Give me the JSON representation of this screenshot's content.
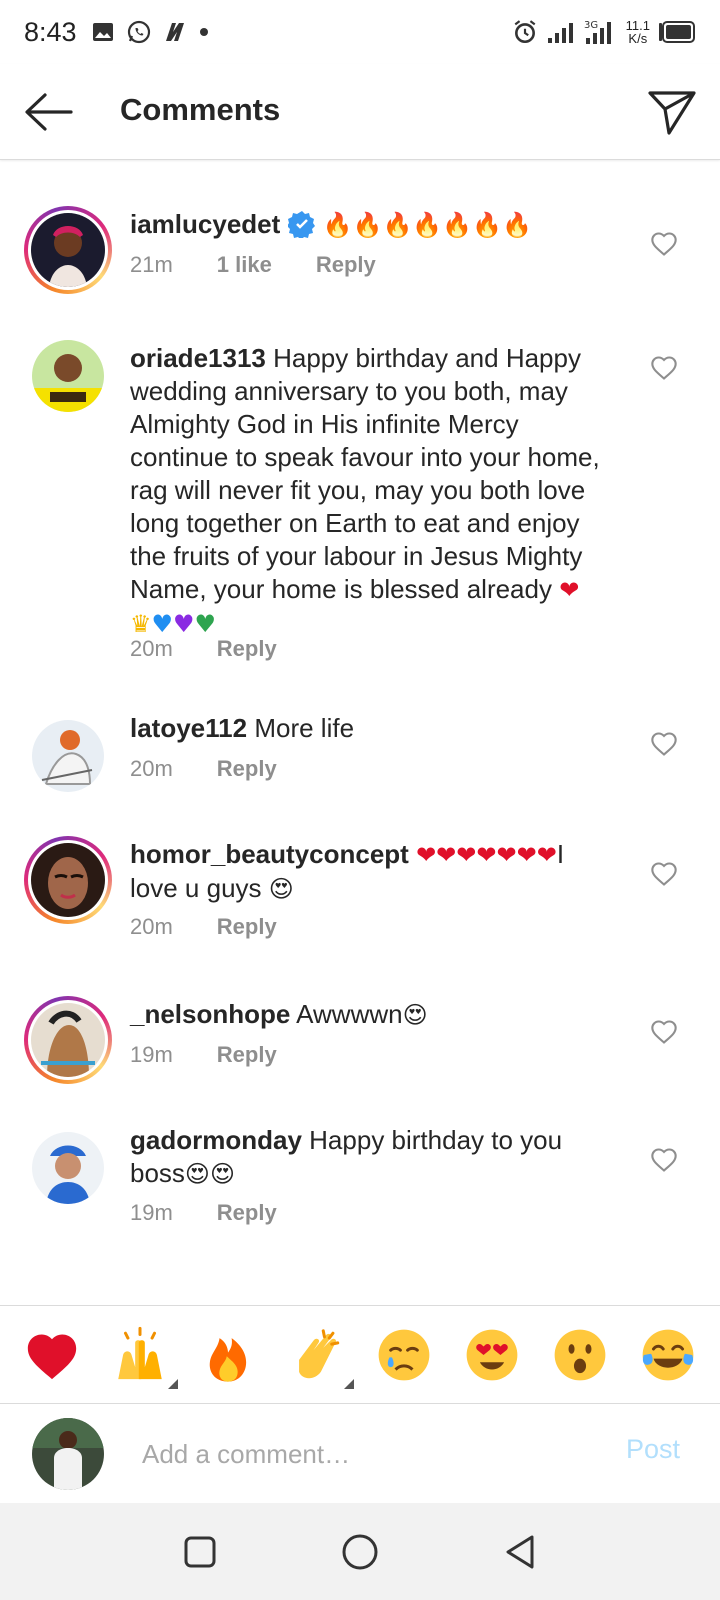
{
  "status_bar": {
    "time": "8:43",
    "net_speed_value": "11.1",
    "net_speed_unit": "K/s",
    "icons": [
      "gallery-icon",
      "whatsapp-icon",
      "n-app-icon",
      "dot-icon",
      "alarm-icon",
      "signal-icon",
      "signal-4g-icon",
      "battery-icon"
    ]
  },
  "header": {
    "title": "Comments",
    "back_icon": "back-arrow-icon",
    "send_icon": "direct-send-icon"
  },
  "comments": [
    {
      "username": "iamlucyedet",
      "verified": true,
      "text": "",
      "emojis": "🔥🔥🔥🔥🔥🔥🔥",
      "time": "21m",
      "likes": "1 like",
      "reply": "Reply",
      "story_ring": true
    },
    {
      "username": "oriade1313",
      "verified": false,
      "text": "Happy birthday and Happy wedding anniversary to you both, may Almighty God in His infinite Mercy continue to speak favour into your home, rag will never fit you, may you both love long together on Earth to eat and enjoy the fruits of your labour in Jesus Mighty Name, your home is blessed already",
      "emojis": "❤👑💙💜💚",
      "time": "20m",
      "likes": "",
      "reply": "Reply",
      "story_ring": false
    },
    {
      "username": "latoye112",
      "verified": false,
      "text": "More life",
      "emojis": "",
      "time": "20m",
      "likes": "",
      "reply": "Reply",
      "story_ring": false
    },
    {
      "username": "homor_beautyconcept",
      "verified": false,
      "text": "I love u guys",
      "emojis_before": "❤❤❤❤❤❤❤",
      "emojis": "😍",
      "time": "20m",
      "likes": "",
      "reply": "Reply",
      "story_ring": true
    },
    {
      "username": "_nelsonhope",
      "verified": false,
      "text": "Awwwwn",
      "emojis": "😍",
      "time": "19m",
      "likes": "",
      "reply": "Reply",
      "story_ring": true
    },
    {
      "username": "gadormonday",
      "verified": false,
      "text": "Happy birthday to you boss",
      "emojis": "😍😍",
      "time": "19m",
      "likes": "",
      "reply": "Reply",
      "story_ring": false
    }
  ],
  "reactions": [
    "red-heart",
    "raised-hands",
    "fire",
    "clapping-hands",
    "crying-face",
    "heart-eyes-face",
    "surprised-face",
    "tears-of-joy-face"
  ],
  "comment_input": {
    "placeholder": "Add a comment…",
    "value": "",
    "post_label": "Post"
  },
  "nav_bar": [
    "recents-square-icon",
    "home-circle-icon",
    "back-triangle-icon"
  ],
  "colors": {
    "accent_blue": "#0095f6",
    "post_disabled": "#b2dffc",
    "meta_gray": "#8e8e8e",
    "text": "#262626"
  }
}
